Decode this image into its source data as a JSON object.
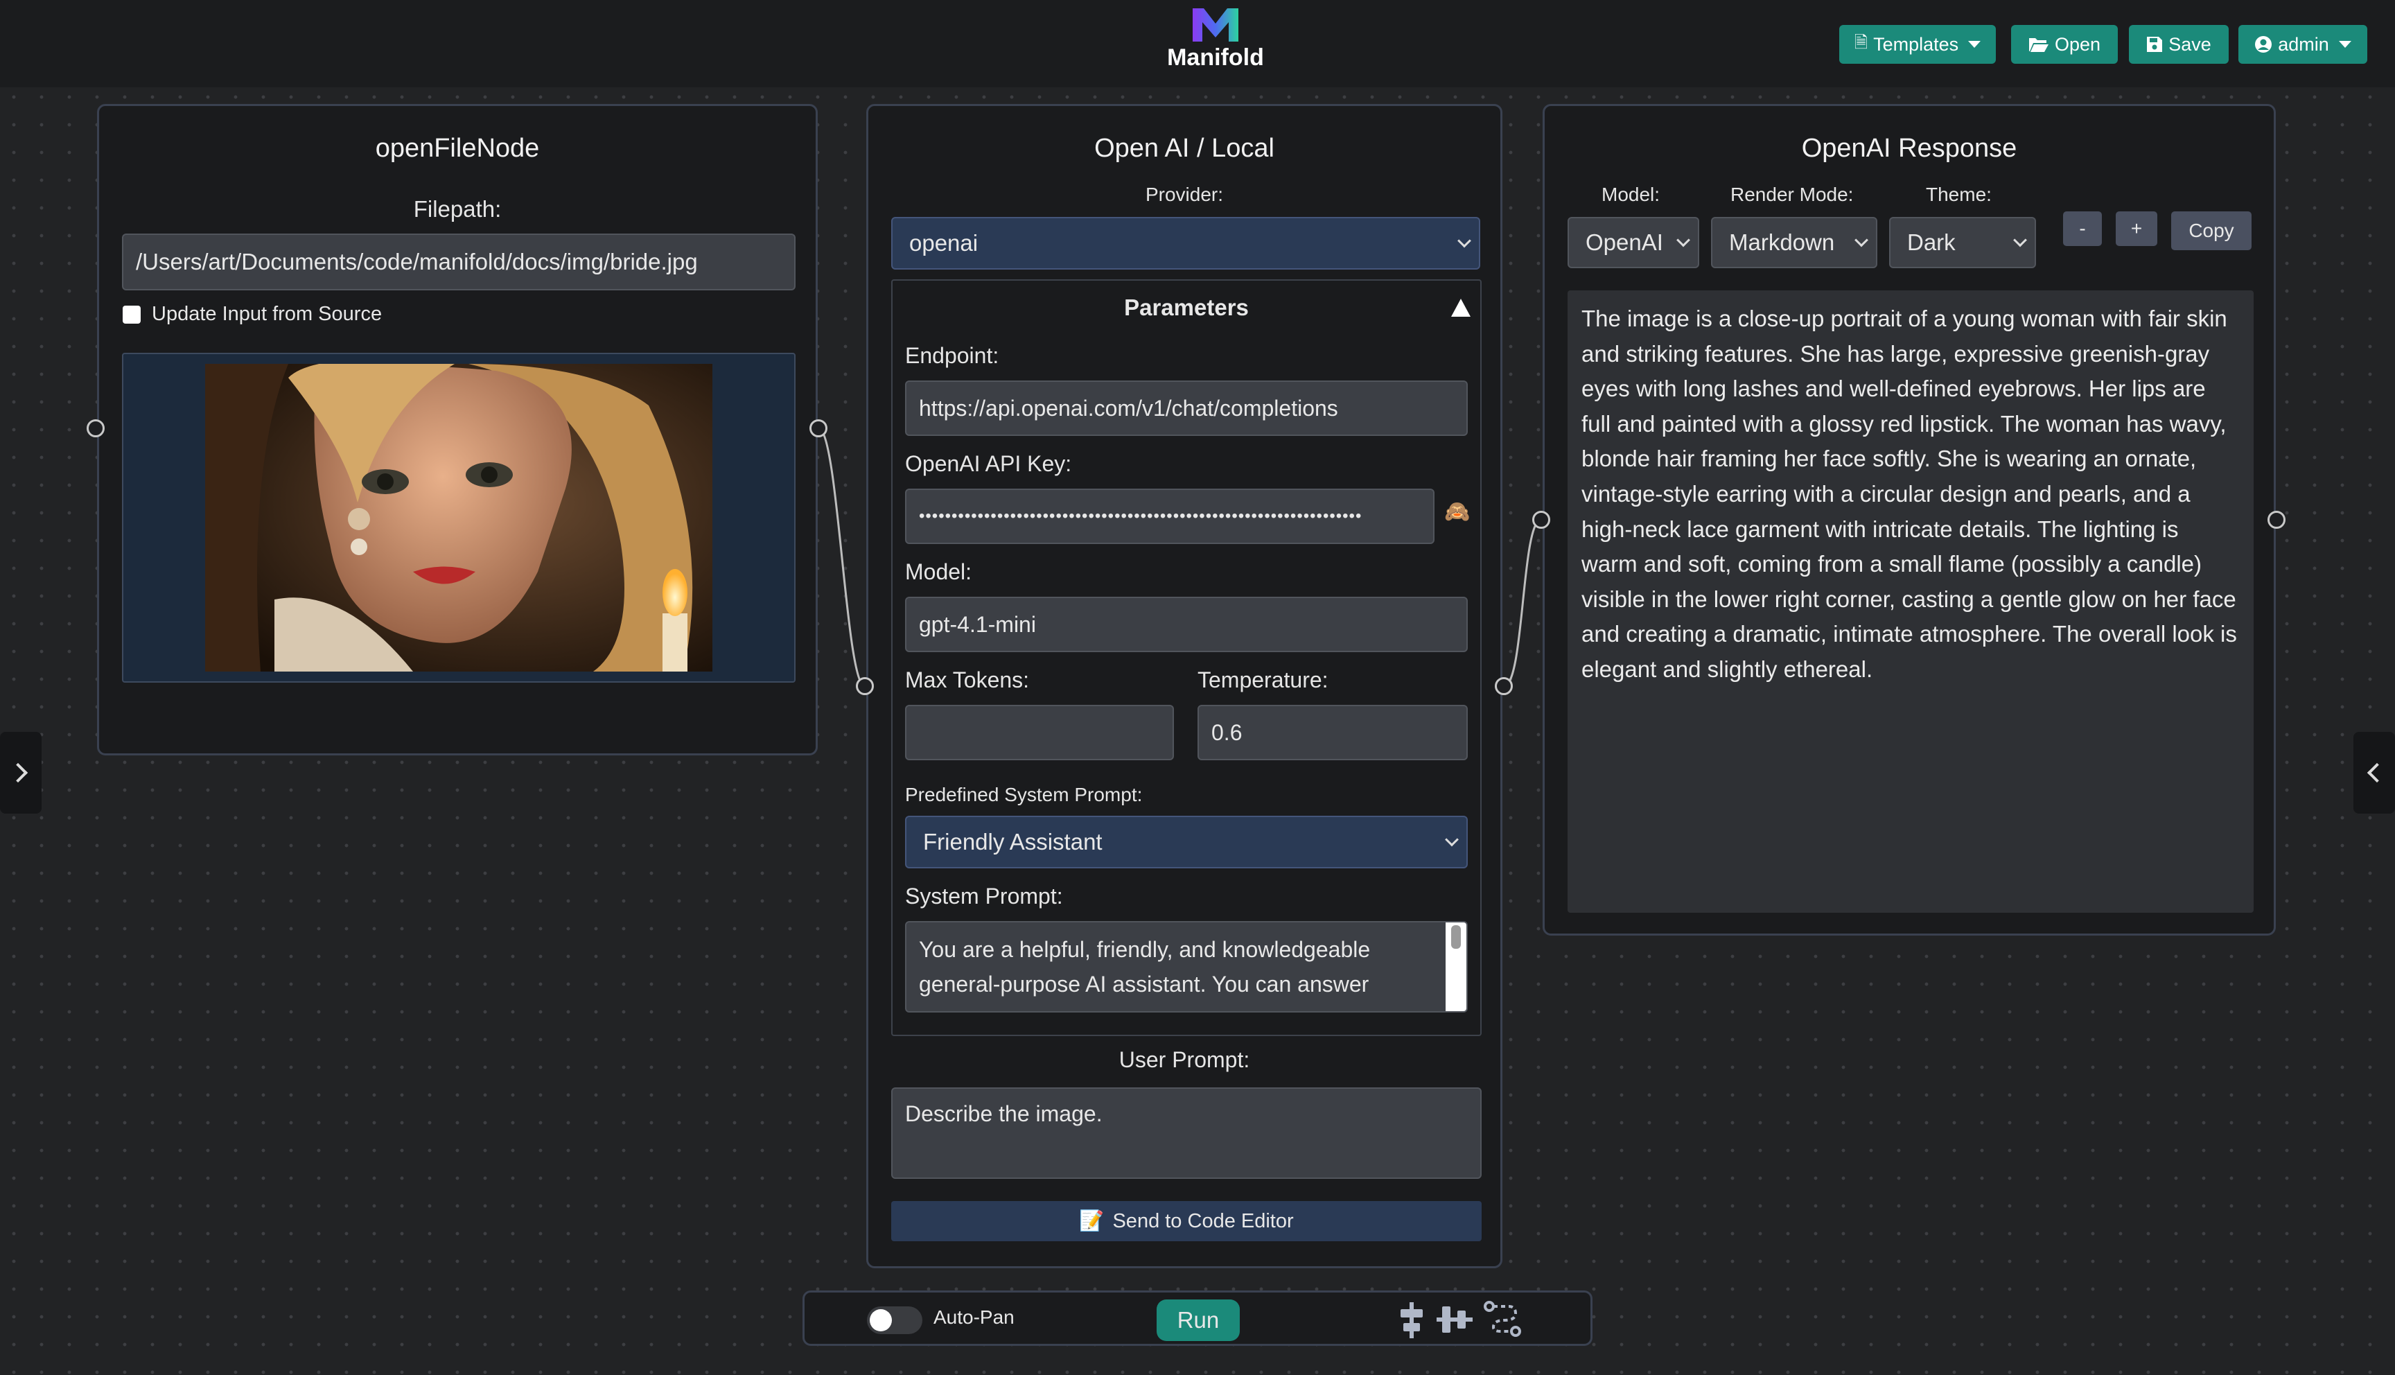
{
  "app": {
    "title": "Manifold"
  },
  "toolbar": {
    "templates_label": "Templates",
    "open_label": "Open",
    "save_label": "Save",
    "user_label": "admin",
    "accent": "#1b8a7a"
  },
  "open_file_node": {
    "title": "openFileNode",
    "filepath_label": "Filepath:",
    "filepath_value": "/Users/art/Documents/code/manifold/docs/img/bride.jpg",
    "update_checkbox_label": "Update Input from Source"
  },
  "llm_node": {
    "title": "Open AI / Local",
    "provider_label": "Provider:",
    "provider_value": "openai",
    "parameters_title": "Parameters",
    "endpoint_label": "Endpoint:",
    "endpoint_value": "https://api.openai.com/v1/chat/completions",
    "api_key_label": "OpenAI API Key:",
    "api_key_value": "••••••••••••••••••••••••••••••••••••••••••••••••••••••••••••••••••••",
    "model_label": "Model:",
    "model_value": "gpt-4.1-mini",
    "max_tokens_label": "Max Tokens:",
    "max_tokens_value": "",
    "temperature_label": "Temperature:",
    "temperature_value": "0.6",
    "predefined_prompt_label": "Predefined System Prompt:",
    "predefined_prompt_value": "Friendly Assistant",
    "system_prompt_label": "System Prompt:",
    "system_prompt_value": "You are a helpful, friendly, and knowledgeable general-purpose AI assistant. You can answer",
    "user_prompt_label": "User Prompt:",
    "user_prompt_value": "Describe the image.",
    "send_button_label": "Send to Code Editor"
  },
  "response_node": {
    "title": "OpenAI Response",
    "model_label": "Model:",
    "model_value": "OpenAI",
    "render_mode_label": "Render Mode:",
    "render_mode_value": "Markdown",
    "theme_label": "Theme:",
    "theme_value": "Dark",
    "minus_label": "-",
    "plus_label": "+",
    "copy_label": "Copy",
    "response_text": "The image is a close-up portrait of a young woman with fair skin and striking features. She has large, expressive greenish-gray eyes with long lashes and well-defined eyebrows. Her lips are full and painted with a glossy red lipstick. The woman has wavy, blonde hair framing her face softly. She is wearing an ornate, vintage-style earring with a circular design and pearls, and a high-neck lace garment with intricate details. The lighting is warm and soft, coming from a small flame (possibly a candle) visible in the lower right corner, casting a gentle glow on her face and creating a dramatic, intimate atmosphere. The overall look is elegant and slightly ethereal."
  },
  "bottom_bar": {
    "autopan_label": "Auto-Pan",
    "run_label": "Run"
  }
}
